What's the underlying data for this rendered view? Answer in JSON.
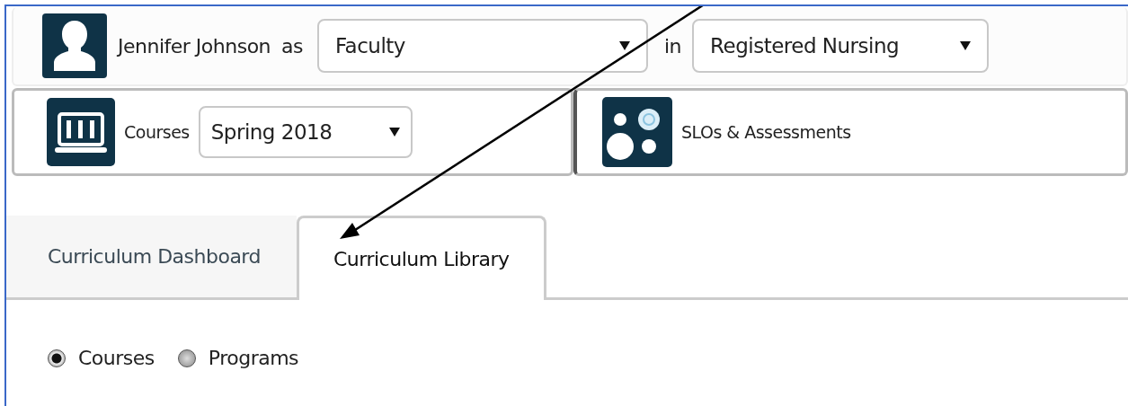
{
  "user": {
    "name": "Jennifer Johnson",
    "as_label": "as",
    "role": "Faculty",
    "in_label": "in",
    "program": "Registered Nursing"
  },
  "modules": [
    {
      "kind": "courses",
      "label": "Courses",
      "term": "Spring 2018"
    },
    {
      "kind": "slos",
      "label": "SLOs & Assessments"
    }
  ],
  "tabs": [
    {
      "label": "Curriculum Dashboard",
      "selected": false
    },
    {
      "label": "Curriculum Library",
      "selected": true
    }
  ],
  "view_options": [
    {
      "label": "Courses",
      "selected": true
    },
    {
      "label": "Programs",
      "selected": false
    }
  ]
}
